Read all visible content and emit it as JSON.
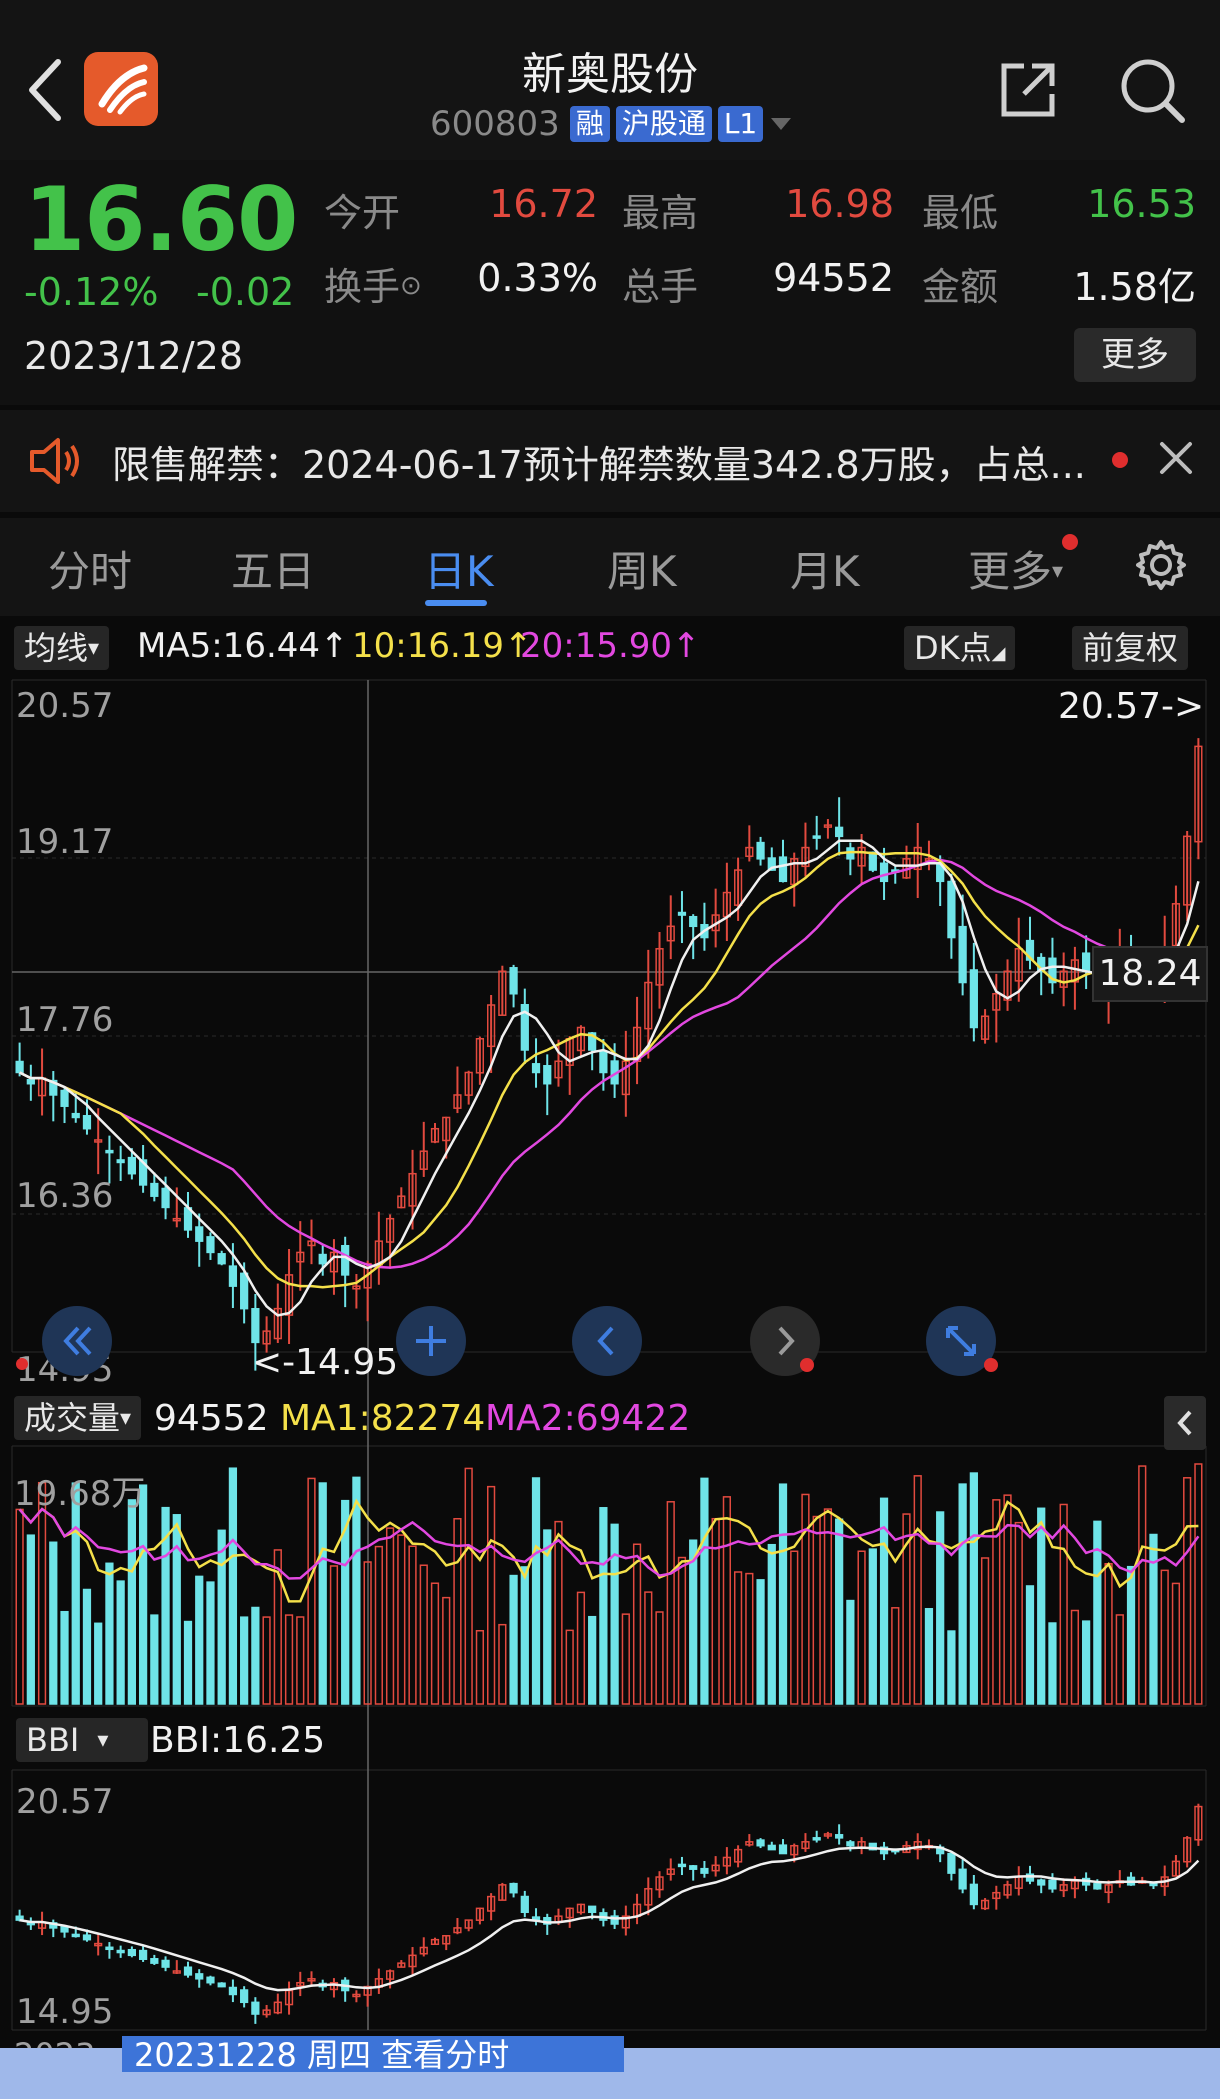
{
  "header": {
    "title": "新奥股份",
    "code": "600803",
    "tags": [
      "融",
      "沪股通",
      "L1"
    ]
  },
  "quote": {
    "price": "16.60",
    "change_pct": "-0.12%",
    "change_abs": "-0.02",
    "date": "2023/12/28",
    "open_label": "今开",
    "open_value": "16.72",
    "high_label": "最高",
    "high_value": "16.98",
    "low_label": "最低",
    "low_value": "16.53",
    "turnover_label": "换手",
    "turnover_value": "0.33%",
    "volume_label": "总手",
    "volume_value": "94552",
    "amount_label": "金额",
    "amount_value": "1.58亿",
    "more_label": "更多"
  },
  "notice": {
    "text": "限售解禁：2024-06-17预计解禁数量342.8万股，占总..."
  },
  "tabs": [
    {
      "label": "分时"
    },
    {
      "label": "五日"
    },
    {
      "label": "日K"
    },
    {
      "label": "周K"
    },
    {
      "label": "月K"
    },
    {
      "label": "更多"
    }
  ],
  "ma_bar": {
    "selector": "均线",
    "ma5": "MA5:16.44↑",
    "ma10": "10:16.19↑",
    "ma20": "20:15.90↑",
    "dk_label": "DK点",
    "adjust_label": "前复权"
  },
  "kline": {
    "y_labels": [
      "20.57",
      "19.17",
      "17.76",
      "16.36",
      "14.95"
    ],
    "max_marker": "20.57->",
    "min_marker": "<-14.95",
    "crosshair_price": "18.24"
  },
  "volume": {
    "selector": "成交量",
    "current": "94552",
    "ma1": "MA1:82274",
    "ma2": "MA2:69422",
    "y_label": "19.68万"
  },
  "bbi": {
    "selector": "BBI",
    "value": "BBI:16.25",
    "y_top": "20.57",
    "y_bottom": "14.95"
  },
  "footer": {
    "date_partial": "2023",
    "tooltip": "20231228 周四 查看分时"
  },
  "colors": {
    "up": "#e24a3f",
    "down": "#6fe4e8",
    "ma5": "#f0f0f0",
    "ma10": "#f4e04a",
    "ma20": "#e248e0",
    "accent": "#4a8df0"
  },
  "chart_data": {
    "type": "candlestick",
    "price_range": [
      14.95,
      20.57
    ],
    "close_series": [
      17.4,
      17.3,
      17.35,
      17.2,
      17.1,
      17.0,
      16.9,
      16.8,
      16.7,
      16.6,
      16.5,
      16.4,
      16.3,
      16.2,
      16.1,
      16.0,
      15.9,
      15.8,
      15.7,
      15.5,
      15.3,
      15.0,
      15.1,
      15.3,
      15.6,
      15.8,
      15.9,
      15.7,
      15.8,
      15.6,
      15.5,
      15.7,
      15.9,
      16.1,
      16.3,
      16.5,
      16.7,
      16.9,
      17.0,
      17.2,
      17.4,
      17.7,
      18.0,
      18.3,
      18.1,
      17.6,
      17.4,
      17.3,
      17.5,
      17.7,
      17.8,
      17.6,
      17.4,
      17.3,
      17.5,
      17.8,
      18.2,
      18.5,
      18.7,
      18.8,
      18.7,
      18.6,
      18.8,
      19.0,
      19.2,
      19.4,
      19.3,
      19.2,
      19.1,
      19.3,
      19.4,
      19.5,
      19.6,
      19.5,
      19.3,
      19.4,
      19.2,
      19.1,
      19.2,
      19.3,
      19.4,
      19.3,
      19.1,
      18.6,
      18.2,
      17.8,
      17.9,
      18.1,
      18.3,
      18.5,
      18.4,
      18.3,
      18.2,
      18.3,
      18.4,
      18.3,
      18.2,
      18.3,
      18.4,
      18.3,
      18.4,
      18.3,
      18.5,
      18.9,
      19.5,
      20.3
    ]
  }
}
